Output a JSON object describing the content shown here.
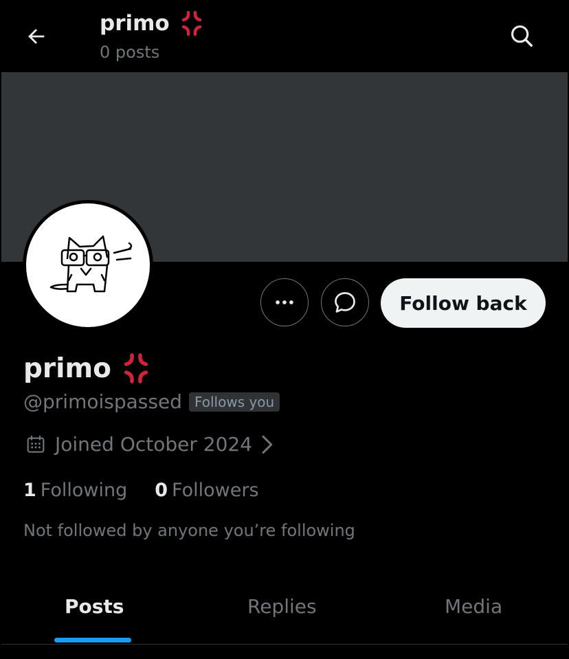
{
  "header": {
    "title": "primo",
    "post_count": "0 posts"
  },
  "profile": {
    "display_name": "primo",
    "handle": "@primoispassed",
    "follows_you_badge": "Follows you",
    "joined": "Joined October 2024",
    "following_count": "1",
    "following_label": "Following",
    "followers_count": "0",
    "followers_label": "Followers",
    "not_followed_text": "Not followed by anyone you’re following"
  },
  "actions": {
    "follow_back_label": "Follow back"
  },
  "tabs": [
    {
      "label": "Posts",
      "active": true
    },
    {
      "label": "Replies",
      "active": false
    },
    {
      "label": "Media",
      "active": false
    }
  ],
  "colors": {
    "background": "#000000",
    "banner": "#333639",
    "accent": "#1d9bf0",
    "anger_emoji": "#d1233a"
  },
  "icons": {
    "back": "back-arrow-icon",
    "search": "search-icon",
    "more": "more-icon",
    "message": "message-icon",
    "calendar": "calendar-icon",
    "chevron": "chevron-right-icon",
    "emoji": "anger-emoji-icon"
  }
}
